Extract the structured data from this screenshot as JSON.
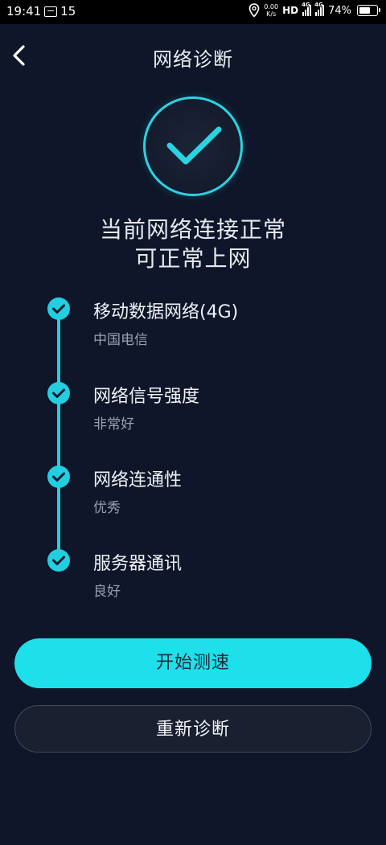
{
  "status_bar": {
    "time": "19:41",
    "notification_count": "15",
    "net_speed_value": "0.00",
    "net_speed_unit": "K/s",
    "hd_label": "HD",
    "sim1_label": "4G",
    "sim2_label": "4G",
    "battery_percent": "74%",
    "battery_level": 0.74
  },
  "header": {
    "title": "网络诊断",
    "back_icon": "chevron-left-icon"
  },
  "result": {
    "icon": "check-circle-icon",
    "accent_color": "#22cfe0",
    "line1": "当前网络连接正常",
    "line2": "可正常上网"
  },
  "steps": [
    {
      "title": "移动数据网络(4G)",
      "value": "中国电信"
    },
    {
      "title": "网络信号强度",
      "value": "非常好"
    },
    {
      "title": "网络连通性",
      "value": "优秀"
    },
    {
      "title": "服务器通讯",
      "value": "良好"
    }
  ],
  "actions": {
    "primary_label": "开始测速",
    "secondary_label": "重新诊断"
  }
}
